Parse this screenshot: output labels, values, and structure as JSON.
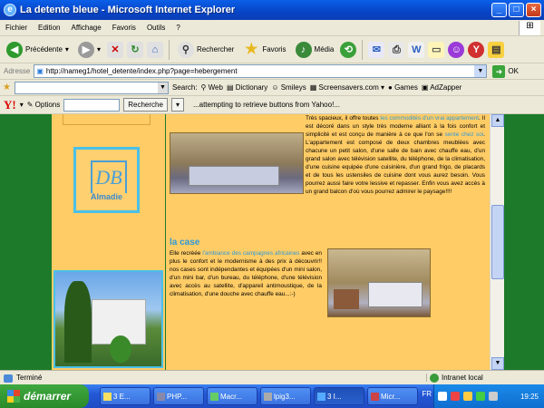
{
  "window": {
    "title": "La detente bleue - Microsoft Internet Explorer"
  },
  "menu": [
    "Fichier",
    "Edition",
    "Affichage",
    "Favoris",
    "Outils",
    "?"
  ],
  "toolbar": {
    "back": "Précédente",
    "search": "Rechercher",
    "favorites": "Favoris",
    "media": "Média"
  },
  "address": {
    "label": "Adresse",
    "url": "http://nameg1/hotel_detente/index.php?page=hebergement",
    "go": "OK"
  },
  "links": {
    "search_label": "Search:",
    "web": "Web",
    "dictionary": "Dictionary",
    "smileys": "Smileys",
    "screensavers": "Screensavers.com",
    "games": "Games",
    "adzapper": "AdZapper"
  },
  "yahoo": {
    "logo": "Y!",
    "options": "Options",
    "search_btn": "Recherche",
    "status": "...attempting to retrieve buttons from Yahoo!..."
  },
  "page": {
    "logo_mono": "DB",
    "logo_name": "Almadie",
    "p1_a": "Très spacieux, il offre toutes ",
    "p1_l1": "les commodités d'un vrai appartement",
    "p1_b": ". Il est décoré dans un style très moderne alliant à la fois confort et simplicité et est conçu de manière à ce que l'on se ",
    "p1_l2": "sente chez soi",
    "p1_c": ". L'appartement est composé de deux chambres meublées avec chacune un petit salon, d'une salle de bain avec chauffe eau, d'un grand salon avec télévision satellite, du téléphone, de la climatisation, d'une cuisine equipée d'une cuisinière, d'un grand frigo, de placards et de tous les ustensiles de cuisine dont vous aurez besoin. Vous pourrez aussi faire votre lessive et repasser. Enfin vous avez accès à un grand balcon d'où vous pourrez admirer le paysage!!!!",
    "case_title": "la case",
    "p2_a": "Elle recrèée ",
    "p2_l": "l'ambiance des campagnes africaines",
    "p2_b": " avec en plus le confort et le modernisme à des prix à découvrir!! nos cases sont indépendantes et équipées d'un mini salon, d'un mini bar, d'un bureau, du téléphone, d'une télévision avec accès au satellite, d'appareil antimoustique, de la climatisation, d'une douche avec chauffe eau...:-)"
  },
  "status": {
    "text": "Terminé",
    "zone": "Intranet local"
  },
  "taskbar": {
    "start": "démarrer",
    "tasks": [
      "3 E...",
      "PHP...",
      "Macr...",
      "lpig3...",
      "3 I...",
      "Micr..."
    ],
    "lang": "FR",
    "clock": "19:25"
  },
  "colors": {
    "page_green": "#1d7a2a",
    "page_orange": "#ffcc66",
    "link_blue": "#2c9ad8"
  }
}
